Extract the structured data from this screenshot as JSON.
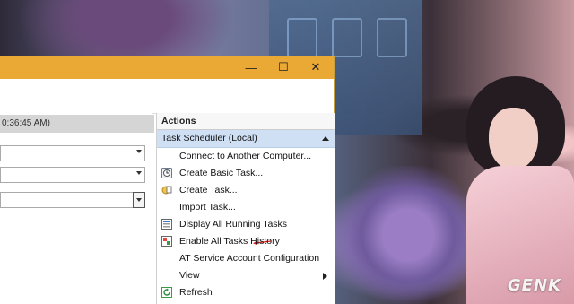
{
  "window": {
    "title_buttons": {
      "minimize": "—",
      "maximize": "☐",
      "close": "✕"
    },
    "left_pane": {
      "time_header": "0:36:45 AM)"
    },
    "actions_pane": {
      "header": "Actions",
      "group": "Task Scheduler (Local)",
      "items": [
        {
          "label": "Connect to Another Computer...",
          "icon": "none"
        },
        {
          "label": "Create Basic Task...",
          "icon": "create-basic-task-icon"
        },
        {
          "label": "Create Task...",
          "icon": "create-task-icon"
        },
        {
          "label": "Import Task...",
          "icon": "none"
        },
        {
          "label": "Display All Running Tasks",
          "icon": "running-tasks-icon"
        },
        {
          "label": "Enable All Tasks History",
          "icon": "tasks-history-icon"
        },
        {
          "label": "AT Service Account Configuration",
          "icon": "none"
        },
        {
          "label": "View",
          "icon": "none",
          "submenu": true
        },
        {
          "label": "Refresh",
          "icon": "refresh-icon"
        }
      ]
    }
  },
  "watermark": "GENK",
  "colors": {
    "titlebar": "#e9a934",
    "group_header": "#cfe0f4",
    "annotation_arrow": "#e02020"
  }
}
